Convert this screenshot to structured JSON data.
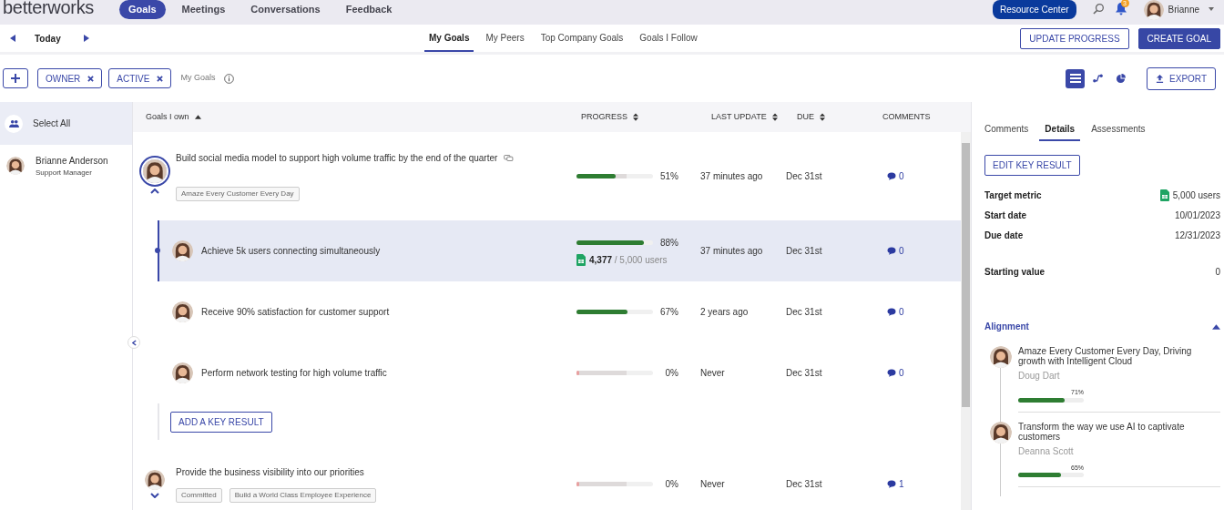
{
  "app": {
    "logo": "betterworks",
    "nav": [
      {
        "label": "Goals",
        "selected": true
      },
      {
        "label": "Meetings",
        "selected": false
      },
      {
        "label": "Conversations",
        "selected": false
      },
      {
        "label": "Feedback",
        "selected": false
      }
    ],
    "resource_center": "Resource Center",
    "notifications": "3",
    "user": "Brianne"
  },
  "toolbar": {
    "date": "Today",
    "tabs": [
      {
        "label": "My Goals",
        "selected": true
      },
      {
        "label": "My Peers",
        "selected": false
      },
      {
        "label": "Top Company Goals",
        "selected": false
      },
      {
        "label": "Goals I Follow",
        "selected": false
      }
    ],
    "buttons": [
      {
        "label": "UPDATE PROGRESS",
        "kind": "outline"
      },
      {
        "label": "CREATE GOAL",
        "kind": "primary"
      }
    ]
  },
  "filters": {
    "chips": [
      "OWNER",
      "ACTIVE"
    ],
    "label": "My Goals",
    "views": [
      {
        "kind": "list",
        "selected": true
      },
      {
        "kind": "alignment",
        "selected": false
      },
      {
        "kind": "pie",
        "selected": false
      }
    ],
    "export": "EXPORT"
  },
  "people": [
    {
      "kind": "all",
      "label": "Select All",
      "selected": true
    },
    {
      "kind": "person",
      "label": "Brianne Anderson",
      "subtitle": "Support Manager",
      "selected": false
    }
  ],
  "table": {
    "columns": [
      {
        "label": "Goals I own",
        "kind": "sorted"
      },
      {
        "label": "PROGRESS",
        "kind": "sortable"
      },
      {
        "label": "LAST UPDATE",
        "kind": "sortable"
      },
      {
        "label": "DUE",
        "kind": "sortable"
      },
      {
        "label": "COMMENTS",
        "kind": "plain"
      }
    ],
    "goals": [
      {
        "title": "Build social media model to support high volume traffic by the end of the quarter",
        "aligned": true,
        "tags": [
          "Amaze Every Customer Every Day"
        ],
        "level": 0.51,
        "percent": "51%",
        "last_update": "37 minutes ago",
        "due": "Dec 31st",
        "comments": "0",
        "expanded": true,
        "key_results": [
          {
            "title": "Achieve 5k users connecting simultaneously",
            "level": 0.88,
            "percent": "88%",
            "metric": {
              "current": "4,377",
              "target": "/ 5,000 users"
            },
            "last_update": "37 minutes ago",
            "due": "Dec 31st",
            "comments": "0",
            "selected": true
          },
          {
            "title": "Receive 90% satisfaction for customer support",
            "level": 0.67,
            "percent": "67%",
            "last_update": "2 years ago",
            "due": "Dec 31st",
            "comments": "0",
            "selected": false
          },
          {
            "title": "Perform network testing for high volume traffic",
            "level": 0,
            "percent": "0%",
            "last_update": "Never",
            "due": "Dec 31st",
            "comments": "0",
            "selected": false
          }
        ],
        "add_button": "ADD A KEY RESULT"
      },
      {
        "title": "Provide the business visibility into our priorities",
        "aligned": false,
        "tags": [
          "Committed",
          "Build a World Class Employee Experience"
        ],
        "level": 0,
        "percent": "0%",
        "last_update": "Never",
        "due": "Dec 31st",
        "comments": "1",
        "expanded": false
      }
    ]
  },
  "details": {
    "tabs": [
      {
        "label": "Comments",
        "selected": false
      },
      {
        "label": "Details",
        "selected": true
      },
      {
        "label": "Assessments",
        "selected": false
      }
    ],
    "edit_button": "EDIT KEY RESULT",
    "fields": [
      {
        "label": "Target metric",
        "value": "5,000 users",
        "kind": "metric"
      },
      {
        "label": "Start date",
        "value": "10/01/2023",
        "kind": "text"
      },
      {
        "label": "Due date",
        "value": "12/31/2023",
        "kind": "text"
      },
      {
        "label": "Starting value",
        "value": "0",
        "kind": "text"
      }
    ],
    "alignment": {
      "title": "Alignment",
      "expanded": true,
      "items": [
        {
          "title": "Amaze Every Customer Every Day, Driving growth with Intelligent Cloud",
          "owner": "Doug Dart",
          "level": 0.71,
          "percent": "71%"
        },
        {
          "title": "Transform the way we use AI to captivate customers",
          "owner": "Deanna Scott",
          "level": 0.65,
          "percent": "65%"
        }
      ]
    }
  }
}
